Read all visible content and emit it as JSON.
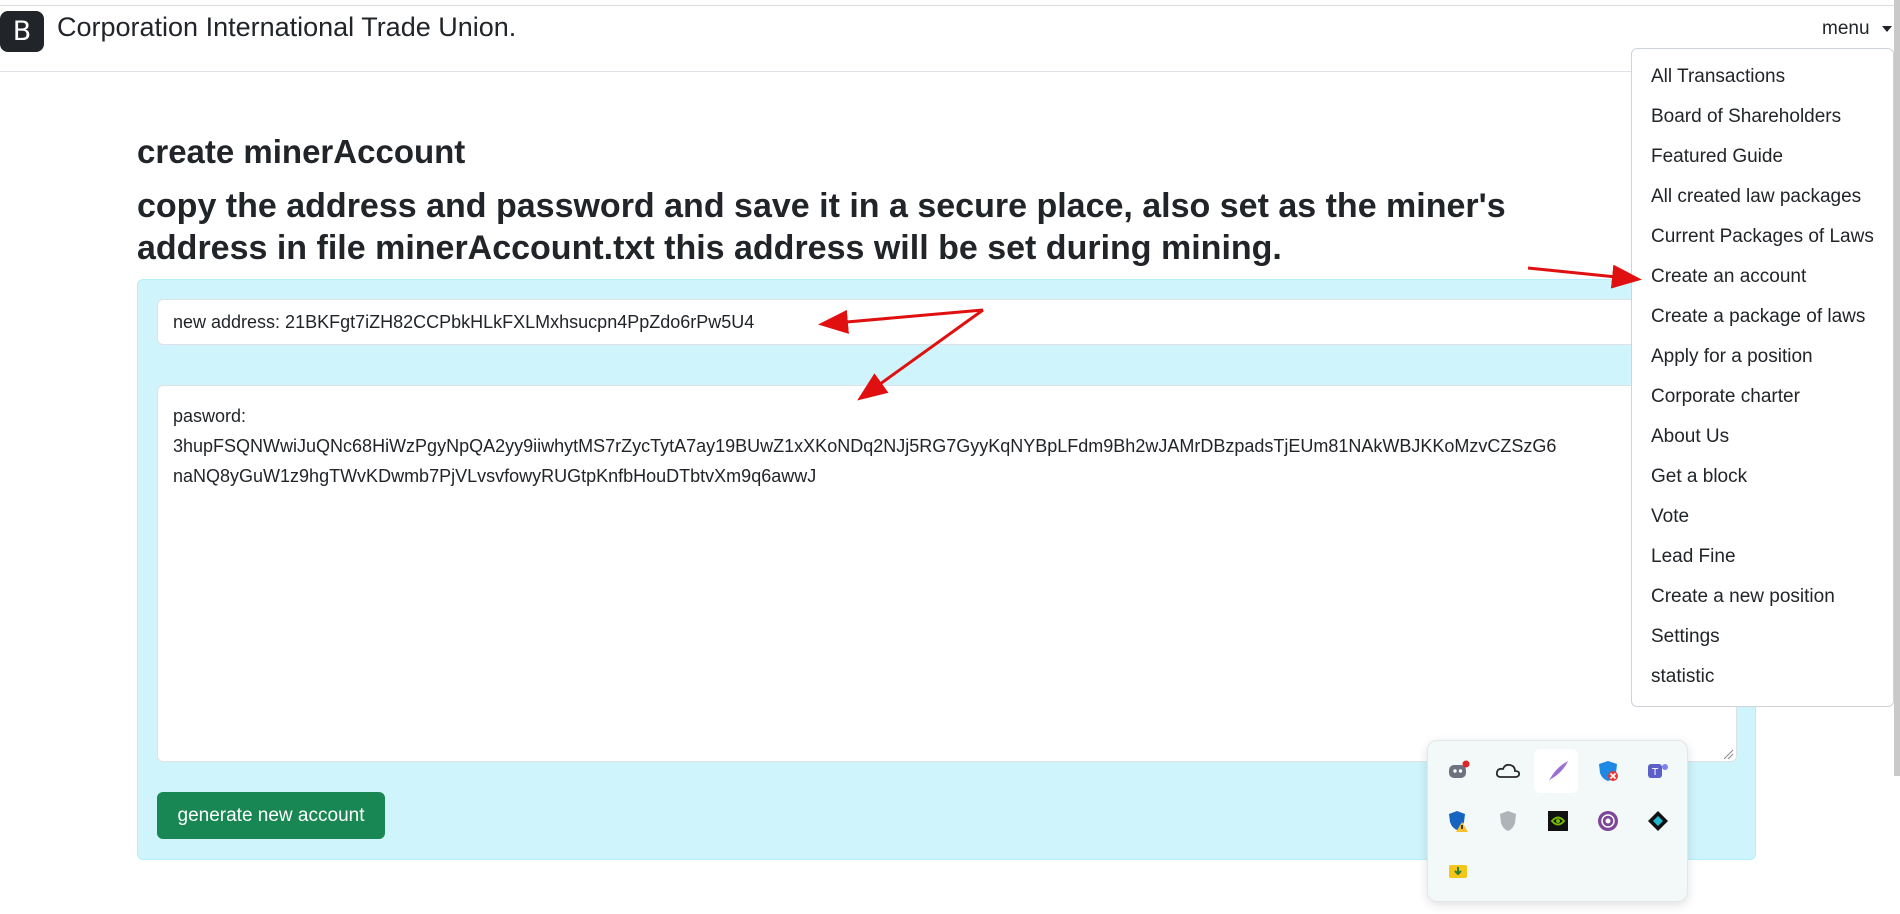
{
  "navbar": {
    "logo_letter": "B",
    "brand": "Corporation International Trade Union.",
    "menu_label": "menu"
  },
  "menu": {
    "items": [
      "All Transactions",
      "Board of Shareholders",
      "Featured Guide",
      "All created law packages",
      "Current Packages of Laws",
      "Create an account",
      "Create a package of laws",
      "Apply for a position",
      "Corporate charter",
      "About Us",
      "Get a block",
      "Vote",
      "Lead Fine",
      "Create a new position",
      "Settings",
      "statistic"
    ]
  },
  "page": {
    "title": "create minerAccount",
    "instructions": "copy the address and password and save it in a secure place, also set as the miner's address in file minerAccount.txt this address will be set during mining."
  },
  "account": {
    "address_text": "new address: 21BKFgt7iZH82CCPbkHLkFXLMxhsucpn4PpZdo6rPw5U4",
    "password_label": "pasword:",
    "password_line1": "3hupFSQNWwiJuQNc68HiWzPgyNpQA2yy9iiwhytMS7rZycTytA7ay19BUwZ1xXKoNDq2NJj5RG7GyyKqNYBpLFdm9Bh2wJAMrDBzpadsTjEUm81NAkWBJKKoMzvCZSzG6",
    "password_line2": "naNQ8yGuW1z9hgTWvKDwmb7PjVLvsvfowyRUGtpKnfbHouDTbtvXm9q6awwJ",
    "generate_label": "generate new account"
  },
  "colors": {
    "panel_bg": "#cff4fc",
    "button_bg": "#198754",
    "annotation_arrow": "#e01010"
  },
  "tray_icons": [
    "discord-icon",
    "onedrive-icon",
    "feather-icon",
    "shield-blocked-icon",
    "teams-icon",
    "defender-warning-icon",
    "gray-shield-icon",
    "nvidia-icon",
    "tor-icon",
    "diamond-app-icon",
    "usb-safe-remove-icon"
  ]
}
